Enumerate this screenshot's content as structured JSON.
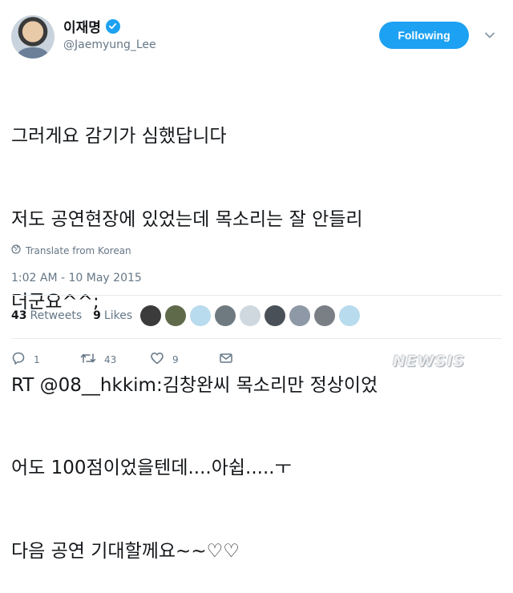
{
  "profile": {
    "display_name": "이재명",
    "handle": "@Jaemyung_Lee",
    "verified": true,
    "avatar_icon": "profile-photo"
  },
  "follow_button": {
    "label": "Following",
    "color": "#1da1f2"
  },
  "more_menu": {
    "icon": "chevron-down-icon"
  },
  "tweet": {
    "lines": [
      "그러게요 감기가 심했답니다",
      "저도 공연현장에 있었는데 목소리는 잘 안들리",
      "더군요^^;",
      "RT @08__hkkim:김창완씨 목소리만 정상이었",
      "어도 100점이었을텐데....아쉽.....ㅜ",
      "다음 공연 기대할께요~~♡♡"
    ],
    "translate_label": "Translate from Korean",
    "timestamp": "1:02 AM - 10 May 2015"
  },
  "stats": {
    "retweets_count": "43",
    "retweets_label": "Retweets",
    "likes_count": "9",
    "likes_label": "Likes",
    "liker_avatars": [
      "#3b3b3b",
      "#5e6a4a",
      "#b9dbee",
      "#6f7a80",
      "#cfd8df",
      "#4a5058",
      "#8e98a6",
      "#7a7f85",
      "#b9dbee"
    ]
  },
  "actions": {
    "reply_count": "1",
    "retweet_count": "43",
    "like_count": "9"
  },
  "watermark": "NEWSIS"
}
